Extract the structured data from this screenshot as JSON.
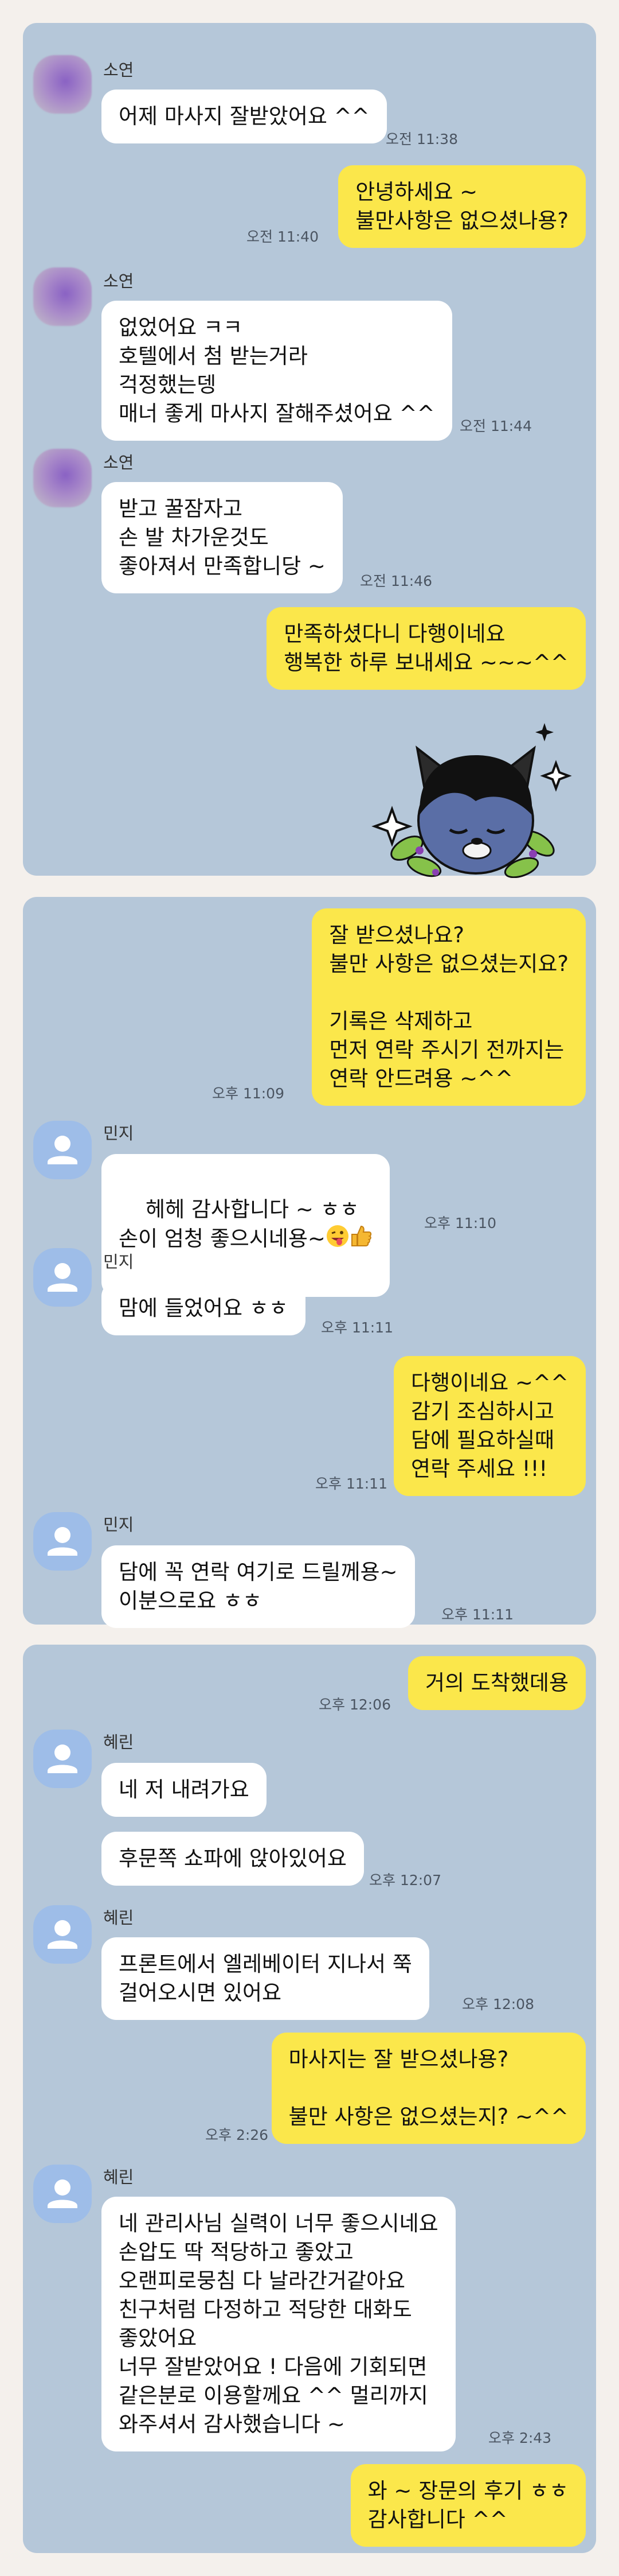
{
  "panel1": {
    "msg1_name": "소연",
    "msg1_text": "어제 마사지 잘받았어요 ^^",
    "msg1_time": "오전 11:38",
    "msg2_text": "안녕하세요 ~\n불만사항은 없으셨나용?",
    "msg2_time": "오전 11:40",
    "msg3_name": "소연",
    "msg3_text": "없었어요 ㅋㅋ\n호텔에서 첨 받는거라\n걱정했는뎅\n매너 좋게 마사지 잘해주셨어요 ^^",
    "msg3_time": "오전 11:44",
    "msg4_name": "소연",
    "msg4_text": "받고 꿀잠자고\n손 발 차가운것도\n좋아져서 만족합니당 ~",
    "msg4_time": "오전 11:46",
    "msg5_text": "만족하셨다니 다행이네요\n행복한 하루 보내세요 ~~~^^",
    "sticker": "character-sticker-icon"
  },
  "panel2": {
    "msg1_text": "잘 받으셨나요?\n불만 사항은 없으셨는지요?\n\n기록은 삭제하고\n먼저 연락 주시기 전까지는\n연락 안드려용 ~^^",
    "msg1_time": "오후 11:09",
    "msg2_name": "민지",
    "msg2_line1": "헤헤 감사합니다 ~ ㅎㅎ",
    "msg2_line2": "손이 엄청 좋으시네용~",
    "msg2_emoji_1": "tongue-wink-emoji-icon",
    "msg2_emoji_2": "thumbs-up-emoji-icon",
    "msg2_time": "오후 11:10",
    "msg3_name": "민지",
    "msg3_text": "맘에 들었어요 ㅎㅎ",
    "msg3_time": "오후 11:11",
    "msg4_text": "다행이네요 ~^^\n감기 조심하시고\n담에 필요하실때\n연락 주세요 !!!",
    "msg4_time": "오후 11:11",
    "msg5_name": "민지",
    "msg5_text": "담에 꼭 연락 여기로 드릴께용~\n이분으로요 ㅎㅎ",
    "msg5_time": "오후 11:11"
  },
  "panel3": {
    "msg1_text": "거의 도착했데용",
    "msg1_time": "오후 12:06",
    "msg2_name": "혜린",
    "msg2_text": "네 저 내려가요",
    "msg3_text": "후문쪽 쇼파에 앉아있어요",
    "msg3_time": "오후 12:07",
    "msg4_name": "혜린",
    "msg4_text": "프론트에서 엘레베이터 지나서 쭉\n걸어오시면 있어요",
    "msg4_time": "오후 12:08",
    "msg5_text": "마사지는 잘 받으셨나용?\n\n불만 사항은 없으셨는지? ~^^",
    "msg5_time": "오후 2:26",
    "msg6_name": "혜린",
    "msg6_text": "네 관리사님 실력이 너무 좋으시네요\n손압도 딱 적당하고 좋았고\n오랜피로뭉침 다 날라간거같아요\n친구처럼 다정하고 적당한 대화도\n좋았어요\n너무 잘받았어요 ! 다음에 기회되면\n같은분로 이용할께요 ^^ 멀리까지\n와주셔서 감사했습니다 ~",
    "msg6_time": "오후 2:43",
    "msg7_text": "와 ~ 장문의 후기 ㅎㅎ\n감사합니다 ^^"
  },
  "colors": {
    "chat_background": "#b5c7d9",
    "outgoing_bubble": "#fbe74b",
    "incoming_bubble": "#ffffff",
    "default_avatar": "#9ebde8"
  }
}
